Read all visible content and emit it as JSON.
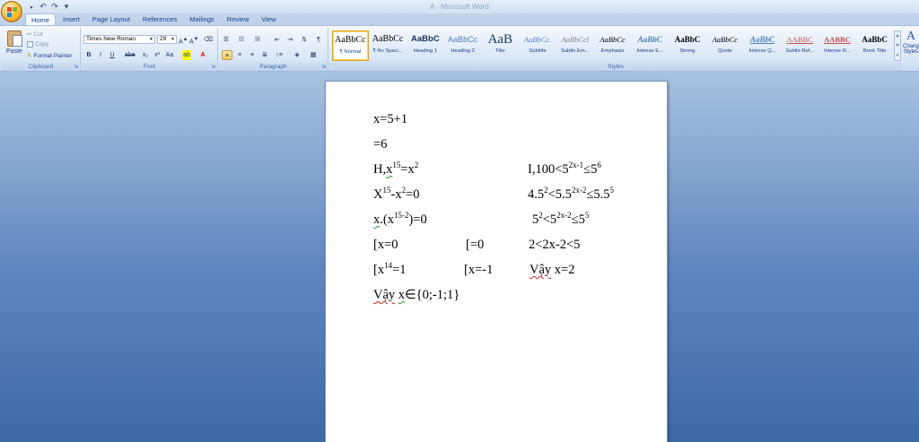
{
  "window": {
    "title": "A - Microsoft Word"
  },
  "tabs": [
    "Home",
    "Insert",
    "Page Layout",
    "References",
    "Mailings",
    "Review",
    "View"
  ],
  "clipboard": {
    "paste": "Paste",
    "cut": "Cut",
    "copy": "Copy",
    "format_painter": "Format Painter",
    "label": "Clipboard"
  },
  "font": {
    "name": "Times New Roman",
    "size": "29",
    "label": "Font"
  },
  "paragraph": {
    "label": "Paragraph"
  },
  "styles": {
    "label": "Styles",
    "items": [
      {
        "sample": "AaBbCc",
        "name": "¶ Normal"
      },
      {
        "sample": "AaBbCc",
        "name": "¶ No Spaci..."
      },
      {
        "sample": "AaBbC",
        "name": "Heading 1"
      },
      {
        "sample": "AaBbCc",
        "name": "Heading 2"
      },
      {
        "sample": "AaB",
        "name": "Title"
      },
      {
        "sample": "AaBbCc.",
        "name": "Subtitle"
      },
      {
        "sample": "AaBbCcl",
        "name": "Subtle Em..."
      },
      {
        "sample": "AaBbCc",
        "name": "Emphasis"
      },
      {
        "sample": "AaBbC",
        "name": "Intense E..."
      },
      {
        "sample": "AaBbC",
        "name": "Strong"
      },
      {
        "sample": "AaBbCc",
        "name": "Quote"
      },
      {
        "sample": "AaBbC",
        "name": "Intense Q..."
      },
      {
        "sample": "AABBC",
        "name": "Subtle Ref..."
      },
      {
        "sample": "AABBC",
        "name": "Intense R..."
      },
      {
        "sample": "AaBbC",
        "name": "Book Title"
      }
    ],
    "change_styles": "Change Styles"
  },
  "document": {
    "line1": "x=5+1",
    "line2": "=6",
    "line3_pre": "H,",
    "line3_x": "x",
    "line3_exp": "15",
    "line3_post": "=x",
    "line3_exp2": "2",
    "line4_a": "X",
    "line4_e1": "15",
    "line4_b": "-x",
    "line4_e2": "2",
    "line4_c": "=0",
    "line5_a": "x",
    "line5_b": ".(x",
    "line5_e": "15-2",
    "line5_c": ")=0",
    "line6_a": "[x=0",
    "line6_b": "[=0",
    "line7_a": "[x",
    "line7_e": "14",
    "line7_b": "=1",
    "line7_c": "[x=-1",
    "line8_a": "Vậy",
    "line8_b": "x",
    "line8_c": "∈{0;-1;1}",
    "r1_a": "I,100<5",
    "r1_e1": "2x-1",
    "r1_b": "≤5",
    "r1_e2": "6",
    "r2_a": "4.5",
    "r2_e1": "2",
    "r2_b": "<5.5",
    "r2_e2": "2x-2",
    "r2_c": "≤5.5",
    "r2_e3": "5",
    "r3_a": "5",
    "r3_e1": "2",
    "r3_b": "<5",
    "r3_e2": "2x-2",
    "r3_c": "≤5",
    "r3_e3": "5",
    "r4": "2<2x-2<5",
    "r5_a": "Vậy",
    "r5_b": " x=2"
  }
}
